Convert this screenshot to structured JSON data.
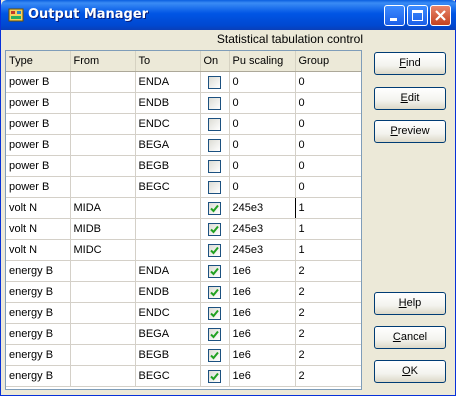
{
  "window": {
    "title": "Output Manager"
  },
  "panel": {
    "subtitle": "Statistical tabulation control"
  },
  "table": {
    "columns": [
      "Type",
      "From",
      "To",
      "On",
      "Pu scaling",
      "Group"
    ],
    "rows": [
      {
        "type": "power B",
        "from": "",
        "to": "ENDA",
        "on": false,
        "pu": "0",
        "group": "0"
      },
      {
        "type": "power B",
        "from": "",
        "to": "ENDB",
        "on": false,
        "pu": "0",
        "group": "0"
      },
      {
        "type": "power B",
        "from": "",
        "to": "ENDC",
        "on": false,
        "pu": "0",
        "group": "0"
      },
      {
        "type": "power B",
        "from": "",
        "to": "BEGA",
        "on": false,
        "pu": "0",
        "group": "0"
      },
      {
        "type": "power B",
        "from": "",
        "to": "BEGB",
        "on": false,
        "pu": "0",
        "group": "0"
      },
      {
        "type": "power B",
        "from": "",
        "to": "BEGC",
        "on": false,
        "pu": "0",
        "group": "0"
      },
      {
        "type": "volt N",
        "from": "MIDA",
        "to": "",
        "on": true,
        "pu": "245e3",
        "group": "1"
      },
      {
        "type": "volt N",
        "from": "MIDB",
        "to": "",
        "on": true,
        "pu": "245e3",
        "group": "1"
      },
      {
        "type": "volt N",
        "from": "MIDC",
        "to": "",
        "on": true,
        "pu": "245e3",
        "group": "1"
      },
      {
        "type": "energy B",
        "from": "",
        "to": "ENDA",
        "on": true,
        "pu": "1e6",
        "group": "2"
      },
      {
        "type": "energy B",
        "from": "",
        "to": "ENDB",
        "on": true,
        "pu": "1e6",
        "group": "2"
      },
      {
        "type": "energy B",
        "from": "",
        "to": "ENDC",
        "on": true,
        "pu": "1e6",
        "group": "2"
      },
      {
        "type": "energy B",
        "from": "",
        "to": "BEGA",
        "on": true,
        "pu": "1e6",
        "group": "2"
      },
      {
        "type": "energy B",
        "from": "",
        "to": "BEGB",
        "on": true,
        "pu": "1e6",
        "group": "2"
      },
      {
        "type": "energy B",
        "from": "",
        "to": "BEGC",
        "on": true,
        "pu": "1e6",
        "group": "2"
      }
    ]
  },
  "buttons": {
    "find": {
      "pre": "",
      "key": "F",
      "post": "ind"
    },
    "edit": {
      "pre": "",
      "key": "E",
      "post": "dit"
    },
    "preview": {
      "pre": "",
      "key": "P",
      "post": "review"
    },
    "help": {
      "pre": "",
      "key": "H",
      "post": "elp"
    },
    "cancel": {
      "pre": "",
      "key": "C",
      "post": "ancel"
    },
    "ok": {
      "pre": "",
      "key": "O",
      "post": "K"
    }
  },
  "colors": {
    "titlebar": "#0055e5",
    "checkmark": "#21a121",
    "close_button": "#c4421f"
  }
}
